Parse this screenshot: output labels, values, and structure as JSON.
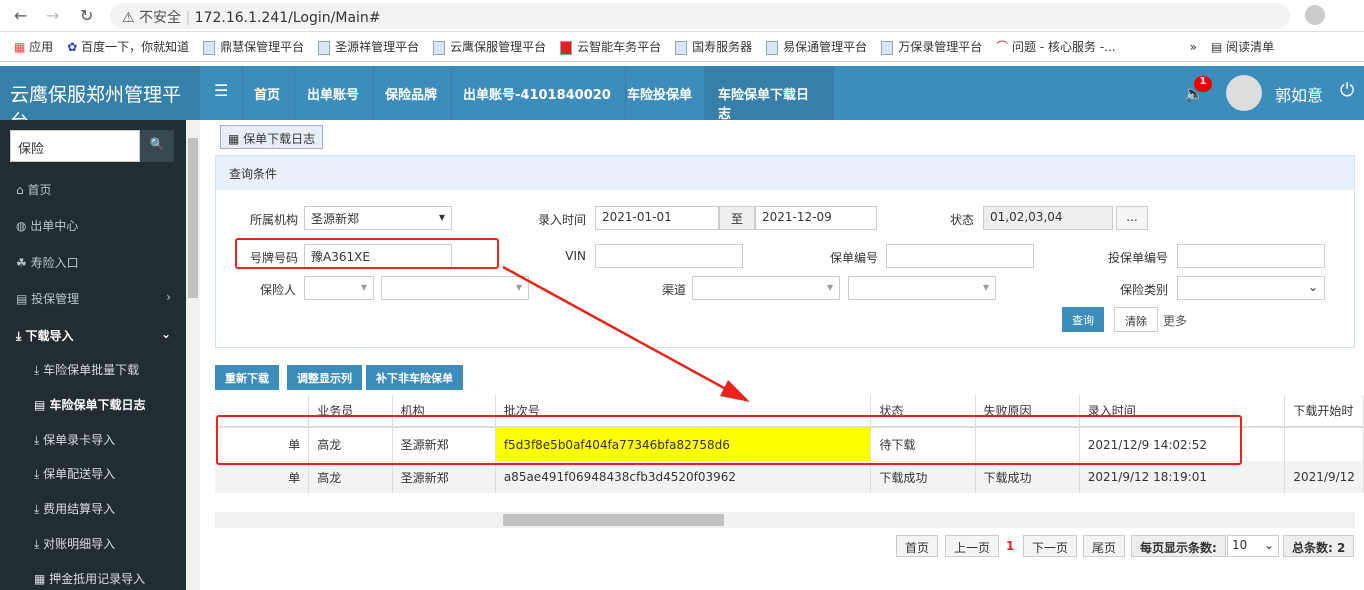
{
  "browser": {
    "security": "不安全",
    "url": "172.16.1.241/Login/Main#",
    "bookmarks": [
      "应用",
      "百度一下，你就知道",
      "鼎慧保管理平台",
      "圣源祥管理平台",
      "云鹰保服管理平台",
      "云智能车务平台",
      "国寿服务器",
      "易保通管理平台",
      "万保录管理平台",
      "问题 - 核心服务 -..."
    ],
    "reading_list": "阅读清单"
  },
  "header": {
    "title": "云鹰保服郑州管理平台",
    "tabs": [
      "首页",
      "出单账号",
      "保险品牌",
      "出单账号-4101840020",
      "车险投保单",
      "车险保单下载日志"
    ],
    "badge": "1",
    "user": "郭如意"
  },
  "sidebar": {
    "search": "保险",
    "items": [
      "首页",
      "出单中心",
      "寿险入口",
      "投保管理",
      "下载导入"
    ],
    "sub": [
      "车险保单批量下载",
      "车险保单下载日志",
      "保单录卡导入",
      "保单配送导入",
      "费用结算导入",
      "对账明细导入",
      "押金抵用记录导入"
    ]
  },
  "page": {
    "crumb": "保单下载日志",
    "panel": "查询条件",
    "labels": {
      "org": "所属机构",
      "time": "录入时间",
      "to": "至",
      "status": "状态",
      "plate": "号牌号码",
      "vin": "VIN",
      "policy": "保单编号",
      "proposal": "投保单编号",
      "insured": "保险人",
      "channel": "渠道",
      "type": "保险类别"
    },
    "values": {
      "org": "圣源新郑",
      "from": "2021-01-01",
      "to": "2021-12-09",
      "status": "01,02,03,04",
      "more_btn": "...",
      "plate": "豫A361XE"
    },
    "buttons": {
      "query": "查询",
      "clear": "清除",
      "more": "更多",
      "redownload": "重新下载",
      "columns": "调整显示列",
      "supplement": "补下非车险保单"
    }
  },
  "table": {
    "headers": [
      "",
      "业务员",
      "机构",
      "批次号",
      "状态",
      "失败原因",
      "录入时间",
      "下载开始时"
    ],
    "rows": [
      [
        "单",
        "高龙",
        "圣源新郑",
        "f5d3f8e5b0af404fa77346bfa82758d6",
        "待下载",
        "",
        "2021/12/9 14:02:52",
        ""
      ],
      [
        "单",
        "高龙",
        "圣源新郑",
        "a85ae491f06948438cfb3d4520f03962",
        "下载成功",
        "下载成功",
        "2021/9/12 18:19:01",
        "2021/9/12"
      ]
    ]
  },
  "pager": {
    "first": "首页",
    "prev": "上一页",
    "current": "1",
    "next": "下一页",
    "last": "尾页",
    "per_page_label": "每页显示条数:",
    "per_page": "10",
    "total": "总条数: 2"
  },
  "colors": {
    "header": "#3c8dbc",
    "sidebar": "#222d32",
    "highlight": "#ffff00",
    "annotation": "#e8231b"
  }
}
